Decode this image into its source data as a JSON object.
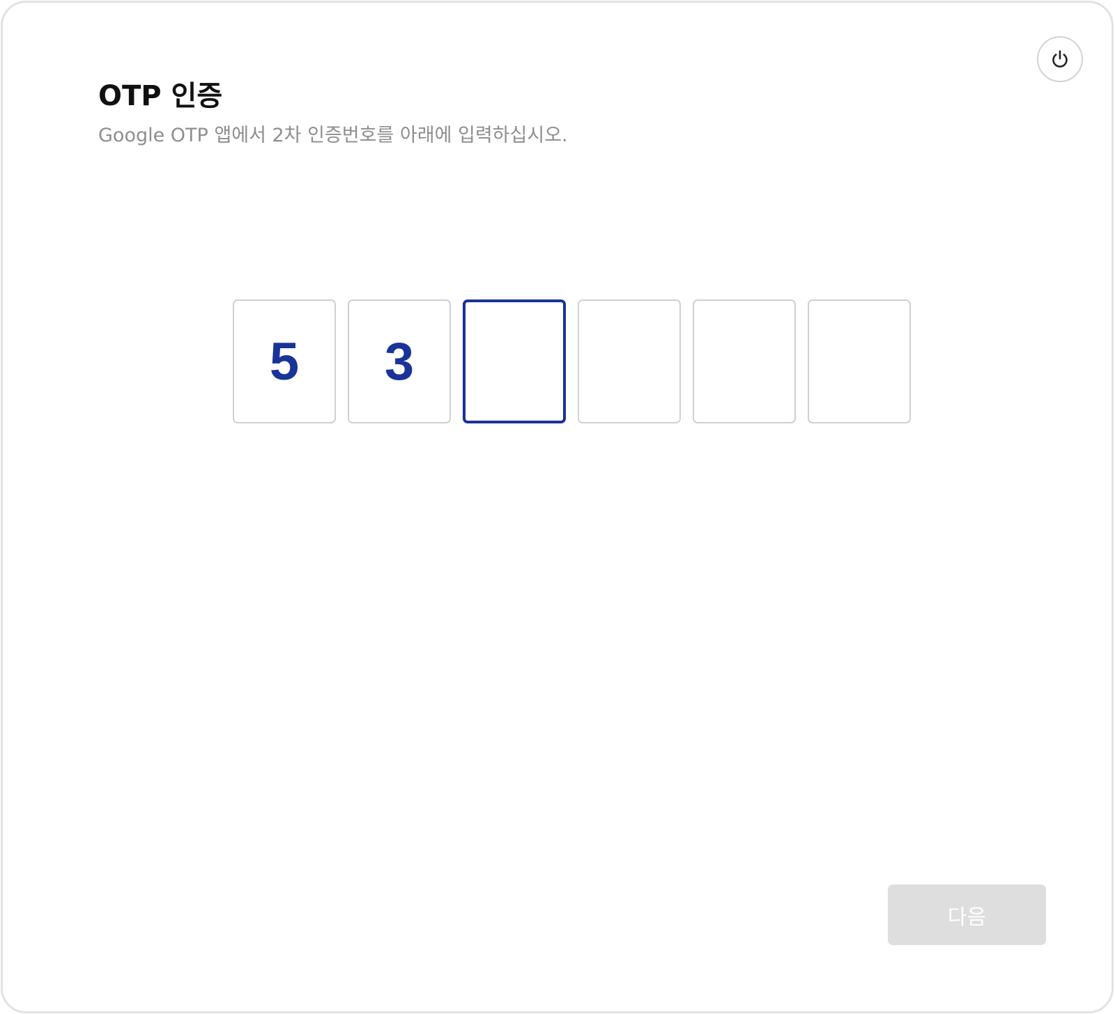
{
  "dialog": {
    "title": "OTP 인증",
    "subtitle": "Google OTP 앱에서 2차 인증번호를 아래에 입력하십시오.",
    "power_icon": "power-icon"
  },
  "otp": {
    "digits": [
      "5",
      "3",
      "",
      "",
      "",
      ""
    ],
    "active_index": 2,
    "digit_color": "#1a3399"
  },
  "footer": {
    "next_label": "다음",
    "next_enabled": false
  }
}
